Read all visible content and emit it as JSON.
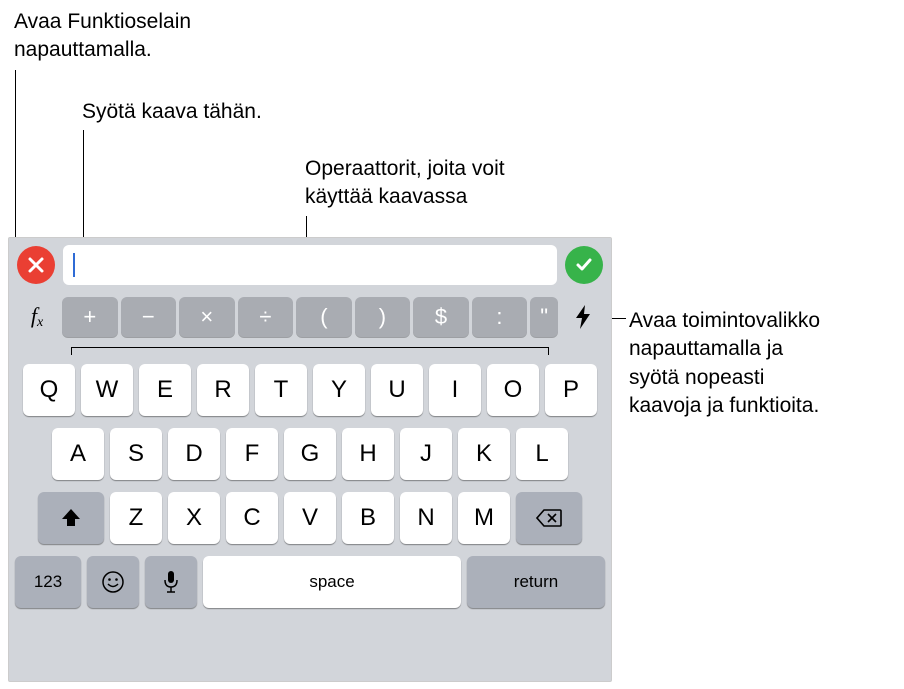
{
  "callouts": {
    "fx": "Avaa Funktioselain\nnapauttamalla.",
    "formula": "Syötä kaava tähän.",
    "operators": "Operaattorit, joita voit\nkäyttää kaavassa",
    "quick": "Avaa toimintovalikko\nnapauttamalla ja\nsyötä nopeasti\nkaavoja ja funktioita."
  },
  "formula_bar": {
    "fx_label": "fx",
    "operators": [
      "+",
      "−",
      "×",
      "÷",
      "(",
      ")",
      "$",
      ":",
      "\""
    ]
  },
  "keyboard": {
    "row1": [
      "Q",
      "W",
      "E",
      "R",
      "T",
      "Y",
      "U",
      "I",
      "O",
      "P"
    ],
    "row2": [
      "A",
      "S",
      "D",
      "F",
      "G",
      "H",
      "J",
      "K",
      "L"
    ],
    "row3": [
      "Z",
      "X",
      "C",
      "V",
      "B",
      "N",
      "M"
    ],
    "numeric_label": "123",
    "space_label": "space",
    "return_label": "return"
  }
}
